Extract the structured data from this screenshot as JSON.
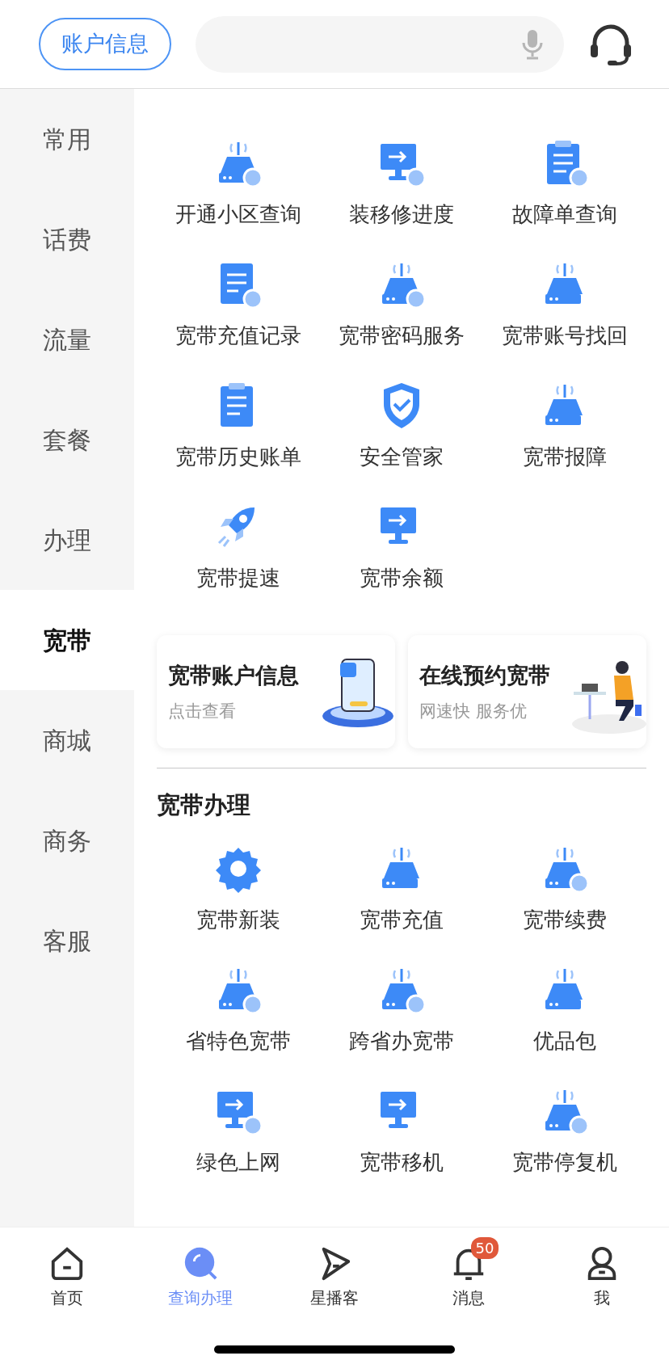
{
  "header": {
    "account_button": "账户信息",
    "search": {
      "voice": true
    }
  },
  "sidebar": {
    "items": [
      {
        "label": "常用",
        "selected": false
      },
      {
        "label": "话费",
        "selected": false
      },
      {
        "label": "流量",
        "selected": false
      },
      {
        "label": "套餐",
        "selected": false
      },
      {
        "label": "办理",
        "selected": false
      },
      {
        "label": "宽带",
        "selected": true
      },
      {
        "label": "商城",
        "selected": false
      },
      {
        "label": "商务",
        "selected": false
      },
      {
        "label": "客服",
        "selected": false
      }
    ]
  },
  "services": [
    {
      "label": "开通小区查询"
    },
    {
      "label": "装移修进度"
    },
    {
      "label": "故障单查询"
    },
    {
      "label": "宽带充值记录"
    },
    {
      "label": "宽带密码服务"
    },
    {
      "label": "宽带账号找回"
    },
    {
      "label": "宽带历史账单"
    },
    {
      "label": "安全管家"
    },
    {
      "label": "宽带报障"
    },
    {
      "label": "宽带提速"
    },
    {
      "label": "宽带余额"
    }
  ],
  "cards": [
    {
      "title": "宽带账户信息",
      "subtitle": "点击查看",
      "kind": "phone"
    },
    {
      "title": "在线预约宽带",
      "subtitle": "网速快 服务优",
      "kind": "person"
    }
  ],
  "broadband_section": {
    "title": "宽带办理",
    "items": [
      {
        "label": "宽带新装"
      },
      {
        "label": "宽带充值"
      },
      {
        "label": "宽带续费"
      },
      {
        "label": "省特色宽带"
      },
      {
        "label": "跨省办宽带"
      },
      {
        "label": "优品包"
      },
      {
        "label": "绿色上网"
      },
      {
        "label": "宽带移机"
      },
      {
        "label": "宽带停复机"
      }
    ]
  },
  "tab_bar": [
    {
      "label": "首页",
      "selected": false
    },
    {
      "label": "查询办理",
      "selected": true
    },
    {
      "label": "星播客",
      "selected": false
    },
    {
      "label": "消息",
      "selected": false,
      "badge": "50"
    },
    {
      "label": "我",
      "selected": false
    }
  ]
}
